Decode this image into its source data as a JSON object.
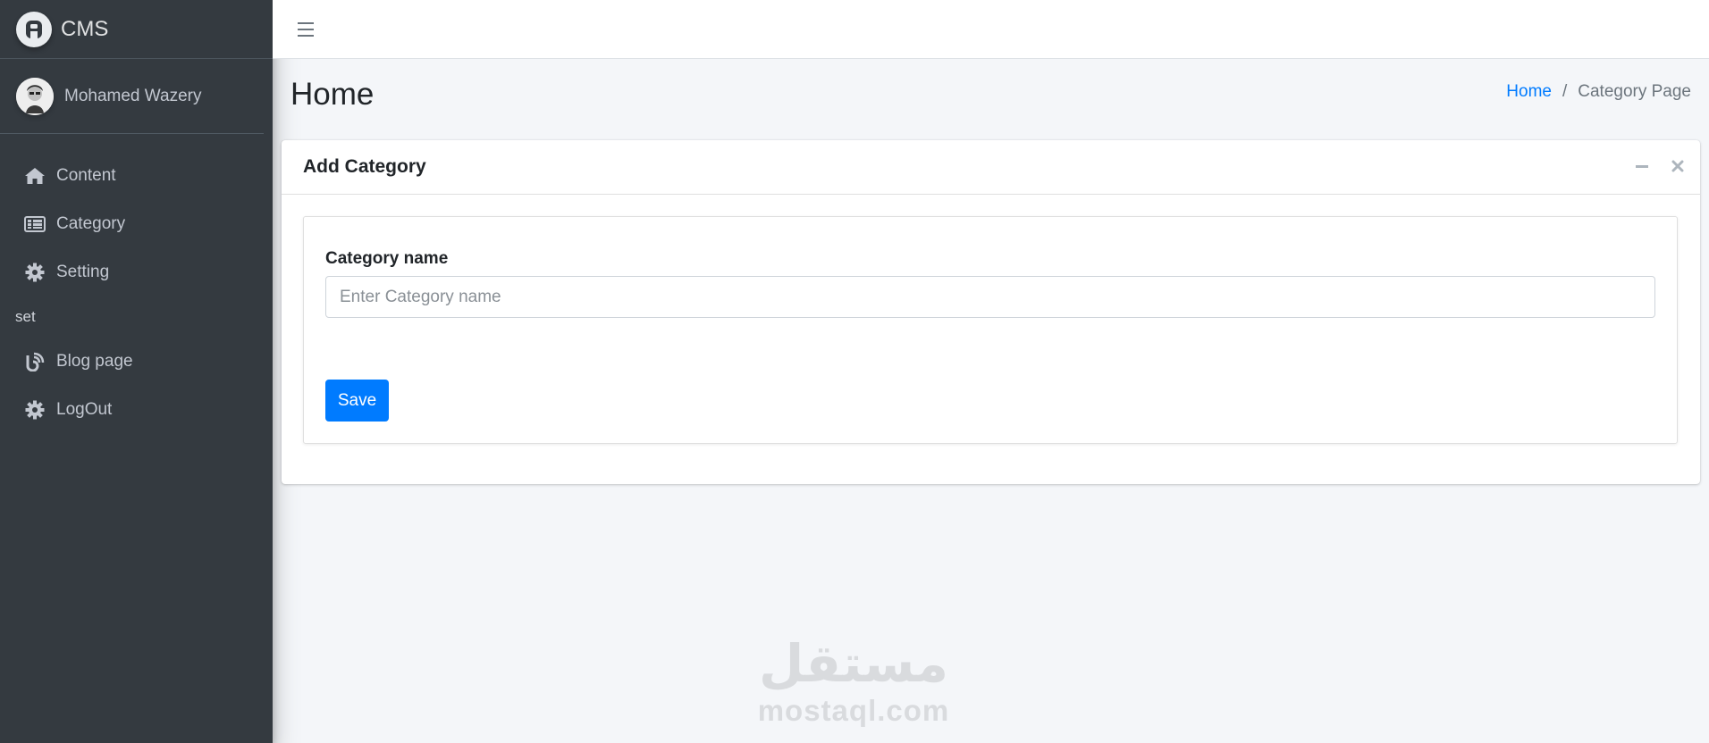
{
  "brand": {
    "name": "CMS"
  },
  "user": {
    "name": "Mohamed Wazery"
  },
  "sidebar": {
    "items": [
      {
        "label": "Content",
        "icon": "home-icon"
      },
      {
        "label": "Category",
        "icon": "list-icon"
      },
      {
        "label": "Setting",
        "icon": "gear-icon"
      }
    ],
    "header": "set",
    "items2": [
      {
        "label": "Blog page",
        "icon": "blog-icon"
      },
      {
        "label": "LogOut",
        "icon": "gear-icon"
      }
    ]
  },
  "page": {
    "title": "Home",
    "breadcrumb": {
      "home": "Home",
      "separator": "/",
      "current": "Category Page"
    }
  },
  "card": {
    "title": "Add Category",
    "form": {
      "label": "Category name",
      "placeholder": "Enter Category name",
      "value": "",
      "save_label": "Save"
    }
  },
  "watermark": {
    "arabic": "مستقل",
    "latin": "mostaql.com"
  },
  "colors": {
    "sidebar": "#343a40",
    "accent": "#007bff",
    "background": "#f4f6f9"
  }
}
